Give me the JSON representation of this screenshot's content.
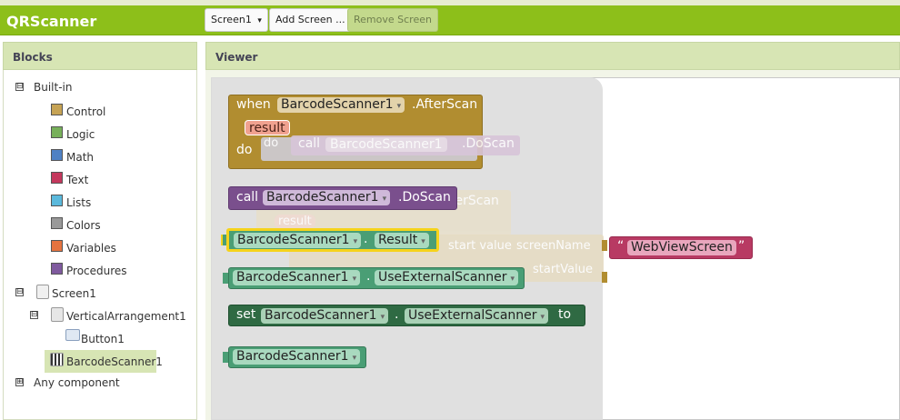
{
  "app": {
    "title": "QRScanner"
  },
  "toolbar": {
    "screen_select": "Screen1",
    "screen_arrow": "▾",
    "add_screen": "Add Screen ...",
    "remove_screen": "Remove Screen"
  },
  "blocks_panel": {
    "title": "Blocks",
    "builtin": "Built-in",
    "builtin_toggle": "⊟",
    "categories": [
      "Control",
      "Logic",
      "Math",
      "Text",
      "Lists",
      "Colors",
      "Variables",
      "Procedures"
    ],
    "category_colors": [
      "#c6a354",
      "#77b05a",
      "#4f81c4",
      "#c4385d",
      "#5bb9dc",
      "#999999",
      "#e5733f",
      "#7f5a9e"
    ],
    "screen": "Screen1",
    "arrangement": "VerticalArrangement1",
    "button": "Button1",
    "scanner": "BarcodeScanner1",
    "any_component": "Any component",
    "collapse_glyph": "⊟",
    "expand_glyph": "⊞"
  },
  "viewer": {
    "title": "Viewer"
  },
  "blocks": {
    "event": {
      "when": "when",
      "component": "BarcodeScanner1",
      "event_name": ".AfterScan",
      "param": "result",
      "do": "do"
    },
    "ghost_call": {
      "do": "do",
      "call": "call",
      "component": "BarcodeScanner1",
      "method": ".DoScan"
    },
    "call": {
      "call": "call",
      "component": "BarcodeScanner1",
      "method": ".DoScan"
    },
    "ghost_bg": {
      "after": "terScan",
      "result": "result",
      "start_value": "start value",
      "screen_name": "screenName",
      "start_value2": "startValue"
    },
    "getter_result": {
      "component": "BarcodeScanner1",
      "dot": ".",
      "property": "Result"
    },
    "text_block": {
      "open_quote": "“",
      "value": "WebViewScreen",
      "close_quote": "”"
    },
    "getter_external": {
      "component": "BarcodeScanner1",
      "dot": ".",
      "property": "UseExternalScanner"
    },
    "setter": {
      "set": "set",
      "component": "BarcodeScanner1",
      "dot": ".",
      "property": "UseExternalScanner",
      "to": "to"
    },
    "component_block": {
      "component": "BarcodeScanner1"
    }
  },
  "colors": {
    "topbar": "#8dbf1a",
    "event_block": "#b18d30",
    "method_block": "#7a4f8d",
    "getter_block": "#4a9e75",
    "setter_block": "#2f6a43",
    "text_block": "#b83a63",
    "selected_highlight": "#f5d31b"
  }
}
